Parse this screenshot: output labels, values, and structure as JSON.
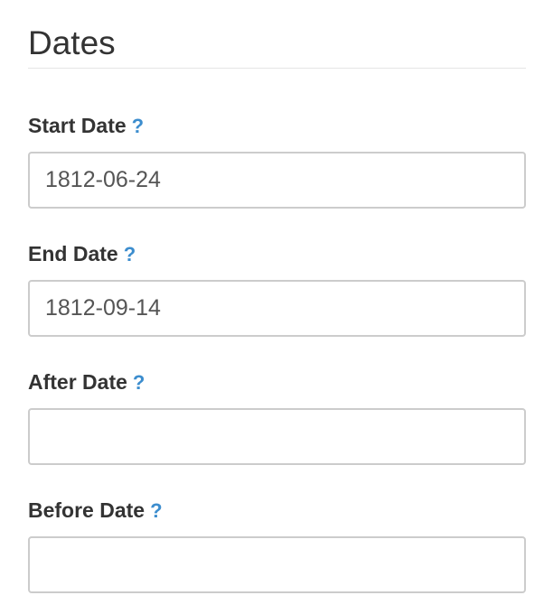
{
  "section": {
    "title": "Dates"
  },
  "help_glyph": "?",
  "fields": [
    {
      "label": "Start Date",
      "value": "1812-06-24",
      "placeholder": ""
    },
    {
      "label": "End Date",
      "value": "1812-09-14",
      "placeholder": ""
    },
    {
      "label": "After Date",
      "value": "",
      "placeholder": ""
    },
    {
      "label": "Before Date",
      "value": "",
      "placeholder": ""
    }
  ],
  "colors": {
    "help_icon": "#3c8dce",
    "input_border": "#cccccc",
    "text": "#333333",
    "divider": "#e5e5e5"
  }
}
